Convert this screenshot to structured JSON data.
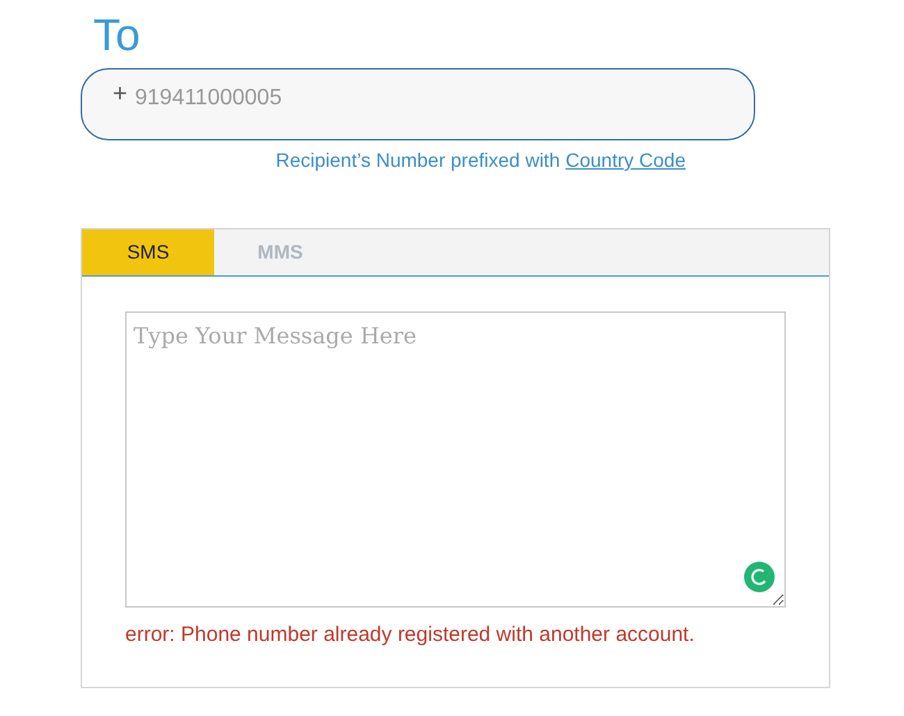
{
  "heading": "To",
  "phone_field": {
    "prefix": "+",
    "placeholder": "919411000005"
  },
  "hint": {
    "text": "Recipient’s Number prefixed with",
    "link": "Country Code"
  },
  "tabs": [
    {
      "label": "SMS",
      "selected": true
    },
    {
      "label": "MMS",
      "selected": false
    }
  ],
  "message_field": {
    "placeholder": "Type Your Message Here"
  },
  "error": "error: Phone number already registered with another account."
}
